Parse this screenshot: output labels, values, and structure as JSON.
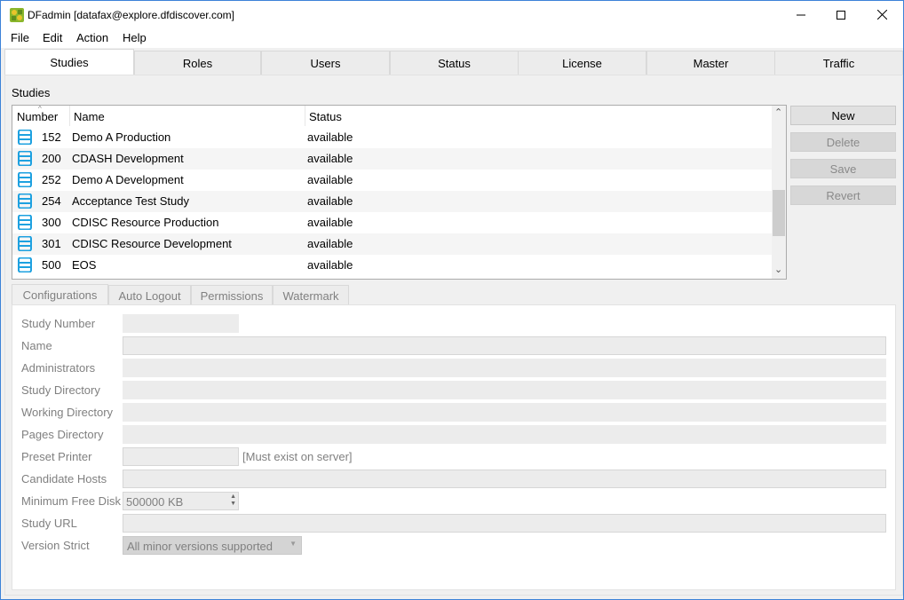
{
  "window": {
    "title": "DFadmin [datafax@explore.dfdiscover.com]",
    "accent": "#3c82d8"
  },
  "menu": [
    "File",
    "Edit",
    "Action",
    "Help"
  ],
  "top_tabs": [
    "Studies",
    "Roles",
    "Users",
    "Status",
    "License",
    "Master",
    "Traffic"
  ],
  "studies": {
    "section_label": "Studies",
    "columns": {
      "number": "Number",
      "name": "Name",
      "status": "Status"
    },
    "rows": [
      {
        "number": "152",
        "name": "Demo A Production",
        "status": "available"
      },
      {
        "number": "200",
        "name": "CDASH Development",
        "status": "available"
      },
      {
        "number": "252",
        "name": "Demo A Development",
        "status": "available"
      },
      {
        "number": "254",
        "name": "Acceptance Test Study",
        "status": "available"
      },
      {
        "number": "300",
        "name": "CDISC Resource Production",
        "status": "available"
      },
      {
        "number": "301",
        "name": "CDISC Resource Development",
        "status": "available"
      },
      {
        "number": "500",
        "name": "EOS",
        "status": "available"
      }
    ],
    "row_icon": "study-database-icon",
    "icon_color": "#1ea1e0"
  },
  "buttons": {
    "new": "New",
    "delete": "Delete",
    "save": "Save",
    "revert": "Revert"
  },
  "inner_tabs": [
    "Configurations",
    "Auto Logout",
    "Permissions",
    "Watermark"
  ],
  "form": {
    "study_number": {
      "label": "Study Number",
      "value": ""
    },
    "name": {
      "label": "Name",
      "value": ""
    },
    "administrators": {
      "label": "Administrators",
      "value": ""
    },
    "study_directory": {
      "label": "Study Directory",
      "value": ""
    },
    "working_directory": {
      "label": "Working Directory",
      "value": ""
    },
    "pages_directory": {
      "label": "Pages Directory",
      "value": ""
    },
    "preset_printer": {
      "label": "Preset Printer",
      "value": "",
      "hint": "[Must exist on server]"
    },
    "candidate_hosts": {
      "label": "Candidate Hosts",
      "value": ""
    },
    "minimum_free_disk": {
      "label": "Minimum Free Disk",
      "value": "500000 KB"
    },
    "study_url": {
      "label": "Study URL",
      "value": ""
    },
    "version_strict": {
      "label": "Version Strict",
      "value": "All minor versions supported"
    }
  }
}
